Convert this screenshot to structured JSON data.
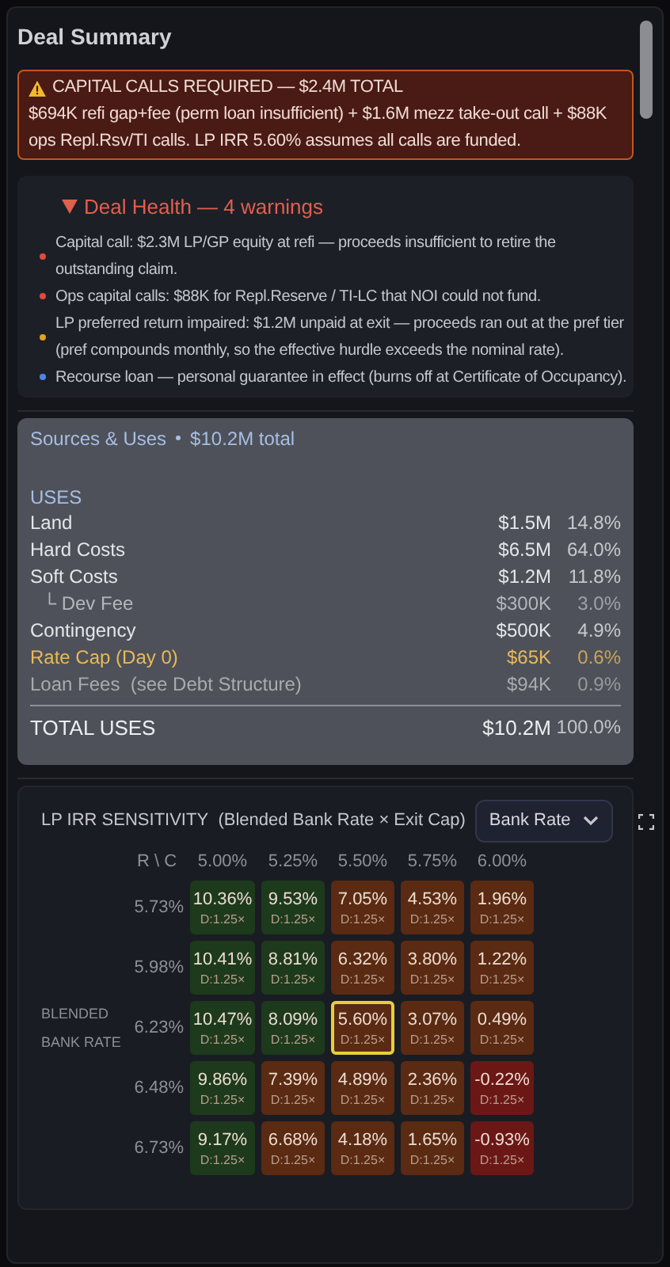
{
  "title": "Deal Summary",
  "alert": {
    "heading": "CAPITAL CALLS REQUIRED — $2.4M TOTAL",
    "body": "$694K refi gap+fee (perm loan insufficient) + $1.6M mezz take-out call + $88K ops Repl.Rsv/TI calls. LP IRR 5.60% assumes all calls are funded."
  },
  "health": {
    "title": "Deal Health — 4 warnings",
    "expanded": true,
    "warnings": [
      {
        "text": "Capital call: $2.3M LP/GP equity at refi — proceeds insufficient to retire the outstanding claim.",
        "color": "#e5483d"
      },
      {
        "text": "Ops capital calls: $88K for Repl.Reserve / TI-LC that NOI could not fund.",
        "color": "#e5483d"
      },
      {
        "text": "LP preferred return impaired: $1.2M unpaid at exit — proceeds ran out at the pref tier (pref compounds monthly, so the effective hurdle exceeds the nominal rate).",
        "color": "#e0a21f"
      },
      {
        "text": "Recourse loan — personal guarantee in effect (burns off at Certificate of Occupancy).",
        "color": "#4a86e8"
      }
    ]
  },
  "sources_uses": {
    "title": "Sources & Uses",
    "total": "$10.2M total",
    "section": "USES",
    "rows": [
      {
        "kind": "main",
        "label": "Land",
        "amount": "$1.5M",
        "pct": "14.8%"
      },
      {
        "kind": "main",
        "label": "Hard Costs",
        "amount": "$6.5M",
        "pct": "64.0%"
      },
      {
        "kind": "main",
        "label": "Soft Costs",
        "amount": "$1.2M",
        "pct": "11.8%"
      },
      {
        "kind": "sub",
        "label": "└ Dev Fee",
        "amount": "$300K",
        "pct": "3.0%"
      },
      {
        "kind": "main",
        "label": "Contingency",
        "amount": "$500K",
        "pct": "4.9%"
      },
      {
        "kind": "cap",
        "label": "Rate Cap (Day 0)",
        "amount": "$65K",
        "pct": "0.6%"
      },
      {
        "kind": "fee",
        "label": "Loan Fees  (see Debt Structure)",
        "amount": "$94K",
        "pct": "0.9%"
      }
    ],
    "total_row": {
      "label": "TOTAL USES",
      "amount": "$10.2M",
      "pct": "100.0%"
    }
  },
  "sensitivity": {
    "title": "LP IRR SENSITIVITY",
    "subtitle": "(Blended Bank Rate × Exit Cap)",
    "select": "Bank Rate",
    "corner": "R \\ C",
    "row_axis": "BLENDED BANK RATE",
    "columns": [
      "5.00%",
      "5.25%",
      "5.50%",
      "5.75%",
      "6.00%"
    ],
    "rows": [
      {
        "rate": "5.73%",
        "cells": [
          {
            "kind": "good",
            "irr": "10.36%",
            "dscr": "D:1.25×",
            "selected": false
          },
          {
            "kind": "good",
            "irr": "9.53%",
            "dscr": "D:1.25×",
            "selected": false
          },
          {
            "kind": "mid",
            "irr": "7.05%",
            "dscr": "D:1.25×",
            "selected": false
          },
          {
            "kind": "mid",
            "irr": "4.53%",
            "dscr": "D:1.25×",
            "selected": false
          },
          {
            "kind": "mid",
            "irr": "1.96%",
            "dscr": "D:1.25×",
            "selected": false
          }
        ]
      },
      {
        "rate": "5.98%",
        "cells": [
          {
            "kind": "good",
            "irr": "10.41%",
            "dscr": "D:1.25×",
            "selected": false
          },
          {
            "kind": "good",
            "irr": "8.81%",
            "dscr": "D:1.25×",
            "selected": false
          },
          {
            "kind": "mid",
            "irr": "6.32%",
            "dscr": "D:1.25×",
            "selected": false
          },
          {
            "kind": "mid",
            "irr": "3.80%",
            "dscr": "D:1.25×",
            "selected": false
          },
          {
            "kind": "mid",
            "irr": "1.22%",
            "dscr": "D:1.25×",
            "selected": false
          }
        ]
      },
      {
        "rate": "6.23%",
        "cells": [
          {
            "kind": "good",
            "irr": "10.47%",
            "dscr": "D:1.25×",
            "selected": false
          },
          {
            "kind": "good",
            "irr": "8.09%",
            "dscr": "D:1.25×",
            "selected": false
          },
          {
            "kind": "mid",
            "irr": "5.60%",
            "dscr": "D:1.25×",
            "selected": true
          },
          {
            "kind": "mid",
            "irr": "3.07%",
            "dscr": "D:1.25×",
            "selected": false
          },
          {
            "kind": "mid",
            "irr": "0.49%",
            "dscr": "D:1.25×",
            "selected": false
          }
        ]
      },
      {
        "rate": "6.48%",
        "cells": [
          {
            "kind": "good",
            "irr": "9.86%",
            "dscr": "D:1.25×",
            "selected": false
          },
          {
            "kind": "mid",
            "irr": "7.39%",
            "dscr": "D:1.25×",
            "selected": false
          },
          {
            "kind": "mid",
            "irr": "4.89%",
            "dscr": "D:1.25×",
            "selected": false
          },
          {
            "kind": "mid",
            "irr": "2.36%",
            "dscr": "D:1.25×",
            "selected": false
          },
          {
            "kind": "bad",
            "irr": "-0.22%",
            "dscr": "D:1.25×",
            "selected": false
          }
        ]
      },
      {
        "rate": "6.73%",
        "cells": [
          {
            "kind": "good",
            "irr": "9.17%",
            "dscr": "D:1.25×",
            "selected": false
          },
          {
            "kind": "mid",
            "irr": "6.68%",
            "dscr": "D:1.25×",
            "selected": false
          },
          {
            "kind": "mid",
            "irr": "4.18%",
            "dscr": "D:1.25×",
            "selected": false
          },
          {
            "kind": "mid",
            "irr": "1.65%",
            "dscr": "D:1.25×",
            "selected": false
          },
          {
            "kind": "bad",
            "irr": "-0.93%",
            "dscr": "D:1.25×",
            "selected": false
          }
        ]
      }
    ]
  }
}
